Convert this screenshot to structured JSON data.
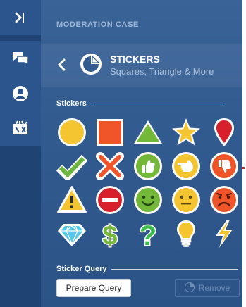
{
  "rail": {
    "items": [
      {
        "name": "collapse-panel",
        "icon": "collapse-right-icon",
        "active": true
      },
      {
        "name": "chat",
        "icon": "chat-bubbles-icon",
        "active": true
      },
      {
        "name": "profile",
        "icon": "user-circle-icon",
        "active": true
      },
      {
        "name": "tools",
        "icon": "toolbox-icon",
        "active": true
      }
    ]
  },
  "header": {
    "title": "MODERATION CASE"
  },
  "subheader": {
    "back_icon": "chevron-left-icon",
    "logo_icon": "sticker-icon",
    "title": "STICKERS",
    "subtitle": "Squares, Triangle & More"
  },
  "stickers_section": {
    "label": "Stickers",
    "items": [
      {
        "name": "circle",
        "icon": "yellow-circle",
        "color": "#f5c531"
      },
      {
        "name": "square",
        "icon": "orange-square",
        "color": "#f0552a"
      },
      {
        "name": "triangle",
        "icon": "green-triangle",
        "color": "#74b83a"
      },
      {
        "name": "star",
        "icon": "yellow-star",
        "color": "#f5c531"
      },
      {
        "name": "map-pin",
        "icon": "red-pin",
        "color": "#d8202c"
      },
      {
        "name": "check",
        "icon": "green-check",
        "color": "#6cb53c"
      },
      {
        "name": "cross",
        "icon": "orange-x",
        "color": "#f0552a"
      },
      {
        "name": "thumbs-up",
        "icon": "green-thumbs-up",
        "color": "#74b83a"
      },
      {
        "name": "point-left",
        "icon": "yellow-hand",
        "color": "#f5c531"
      },
      {
        "name": "thumbs-down",
        "icon": "orange-thumbs-down",
        "color": "#f0552a"
      },
      {
        "name": "warning",
        "icon": "yellow-warning",
        "color": "#f5c531"
      },
      {
        "name": "no-entry",
        "icon": "red-no-entry",
        "color": "#d8202c"
      },
      {
        "name": "happy-face",
        "icon": "green-smiley",
        "color": "#74b83a"
      },
      {
        "name": "neutral-face",
        "icon": "yellow-neutral",
        "color": "#f5c531"
      },
      {
        "name": "sad-face",
        "icon": "red-frown",
        "color": "#f0552a"
      },
      {
        "name": "diamond",
        "icon": "cyan-diamond",
        "color": "#57c9e6"
      },
      {
        "name": "dollar",
        "icon": "green-dollar",
        "color": "#74b83a"
      },
      {
        "name": "question",
        "icon": "green-question",
        "color": "#3dbb4c"
      },
      {
        "name": "lightbulb",
        "icon": "yellow-bulb",
        "color": "#f5c531"
      },
      {
        "name": "lightning",
        "icon": "yellow-bolt",
        "color": "#f5c531"
      }
    ]
  },
  "query_section": {
    "label": "Sticker Query",
    "prepare_label": "Prepare Query",
    "remove_label": "Remove"
  },
  "colors": {
    "rail": "#1f4373",
    "panel": "#315a8f",
    "accent_yellow": "#f5c531",
    "accent_orange": "#f0552a",
    "accent_green": "#74b83a",
    "accent_red": "#d8202c"
  }
}
